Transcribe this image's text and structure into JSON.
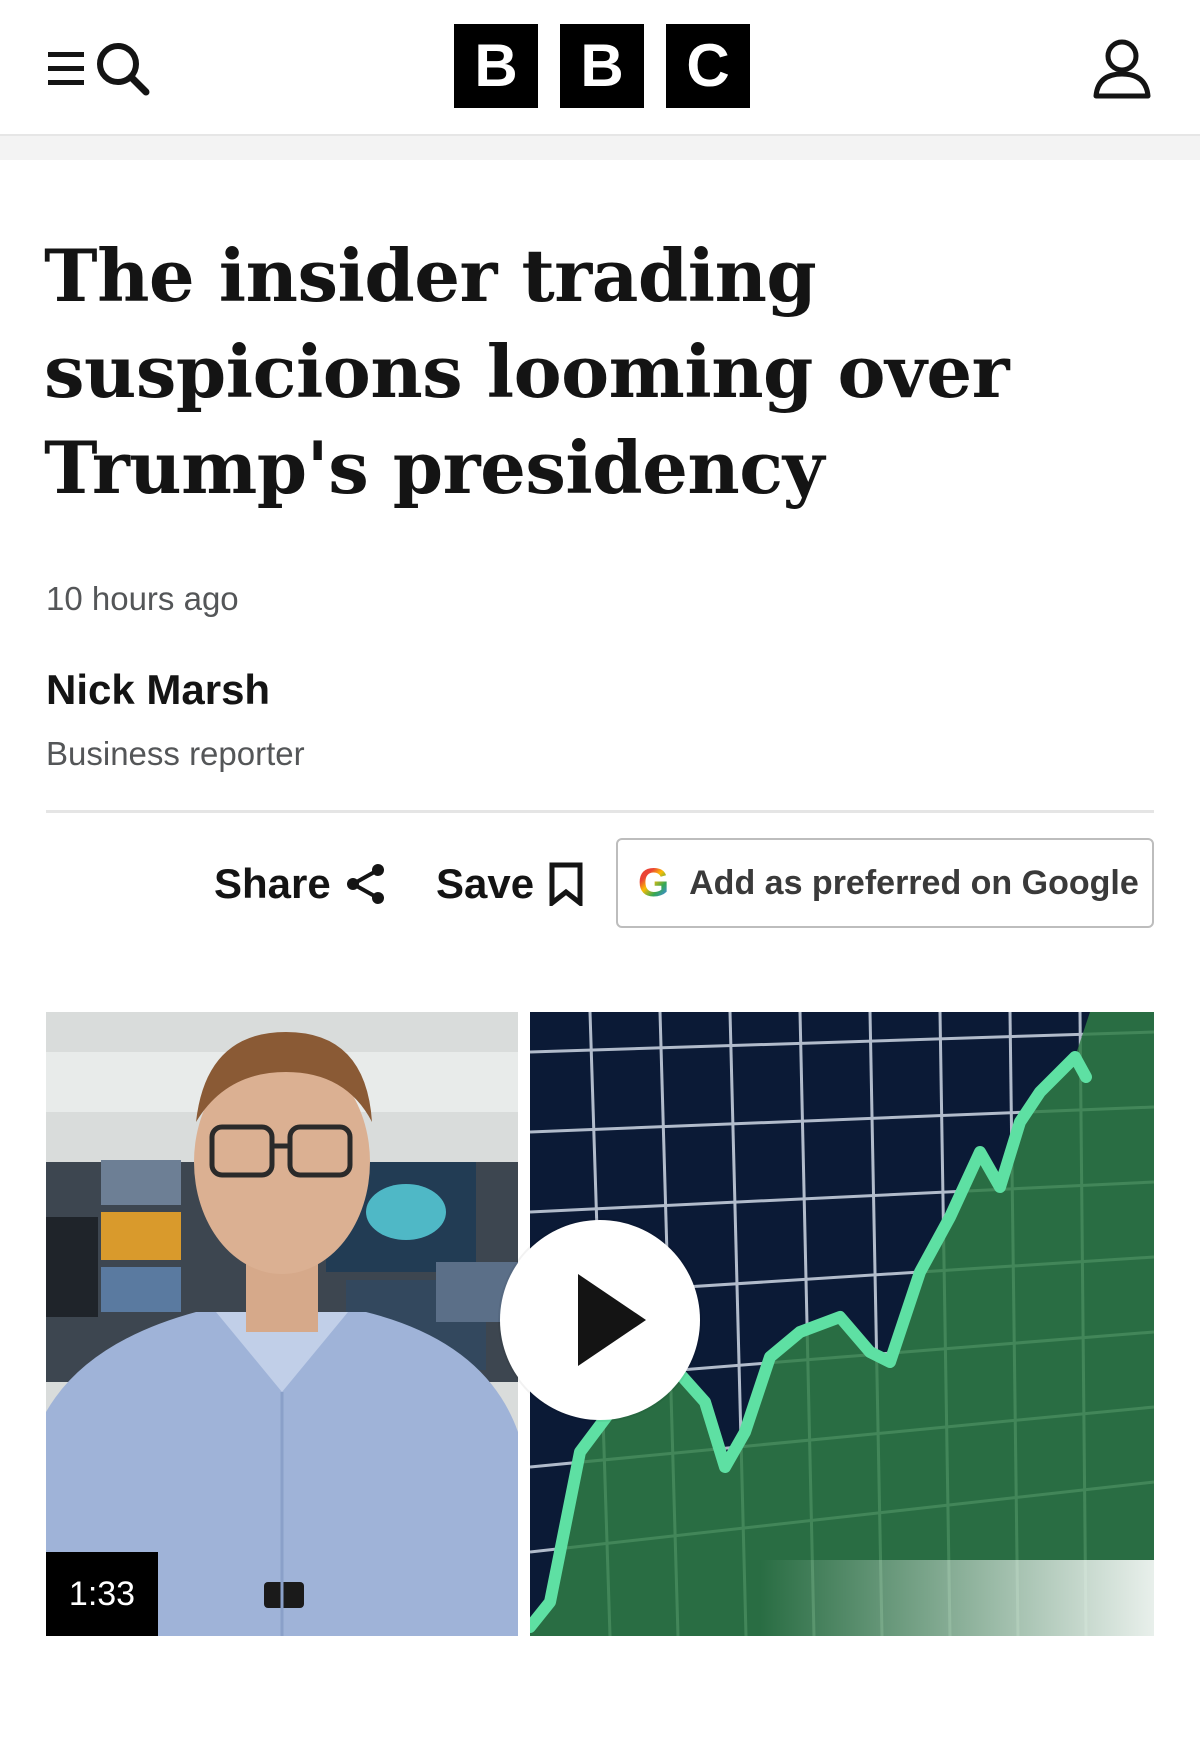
{
  "header": {
    "logo_letters": [
      "B",
      "B",
      "C"
    ],
    "icons": [
      "menu-icon",
      "search-icon",
      "account-icon"
    ]
  },
  "article": {
    "headline_lines": [
      "The insider trading",
      "suspicions looming over",
      "Trump's presidency"
    ],
    "timestamp": "10 hours ago",
    "author_name": "Nick Marsh",
    "author_role": "Business reporter"
  },
  "actions": {
    "share_label": "Share",
    "save_label": "Save",
    "google_label": "Add as preferred on Google",
    "google_letter": "G"
  },
  "video": {
    "duration": "1:33",
    "colors": {
      "chart_bg": "#0b1a36",
      "chart_line": "#5ee0a3",
      "chart_fill": "#2f7d45"
    }
  }
}
